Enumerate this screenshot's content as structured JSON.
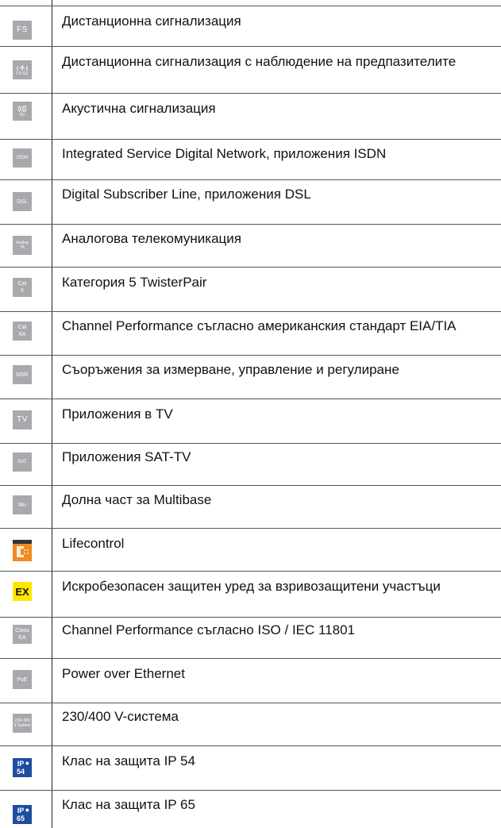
{
  "legend": {
    "rows": [
      {
        "icon": "FS",
        "icon_name": "fs-icon",
        "text": "Дистанционна сигнализация"
      },
      {
        "icon": "FS-SÜ",
        "icon_name": "fs-su-icon",
        "text": "Дистанционна сигнализация с наблюдение на предпазителите"
      },
      {
        "icon": "AS",
        "icon_name": "acoustic-signal-icon",
        "text": "Акустична сигнализация"
      },
      {
        "icon": "ISDN",
        "icon_name": "isdn-icon",
        "text": "Integrated Service Digital Network, приложения ISDN"
      },
      {
        "icon": "DSL",
        "icon_name": "dsl-icon",
        "text": "Digital Subscriber Line, приложения DSL"
      },
      {
        "icon": "Analog TK",
        "icon_name": "analog-tk-icon",
        "text": "Аналогова телекомуникация"
      },
      {
        "icon": "Cat 5",
        "icon_name": "cat5-icon",
        "text": "Категория 5 TwisterPair"
      },
      {
        "icon": "Cat 6A",
        "icon_name": "cat6a-icon",
        "text": "Channel Performance съгласно американския стандарт EIA/TIA"
      },
      {
        "icon": "MSR",
        "icon_name": "msr-icon",
        "text": "Съоръжения за измерване, управление и регулиране"
      },
      {
        "icon": "TV",
        "icon_name": "tv-icon",
        "text": "Приложения в TV"
      },
      {
        "icon": "SAT",
        "icon_name": "sat-icon",
        "text": "Приложения SAT-TV"
      },
      {
        "icon": "Mu",
        "icon_name": "multibase-icon",
        "text": "Долна част за Multibase"
      },
      {
        "icon": "Life Control",
        "icon_name": "lifecontrol-icon",
        "text": "Lifecontrol"
      },
      {
        "icon": "EX",
        "icon_name": "ex-icon",
        "text": "Искробезопасен защитен уред за взривозащитени участъци"
      },
      {
        "icon": "Class EA",
        "icon_name": "class-ea-icon",
        "text": "Channel Performance съгласно ISO / IEC 11801"
      },
      {
        "icon": "PoE",
        "icon_name": "poe-icon",
        "text": "Power over Ethernet"
      },
      {
        "icon": "230/ 400 V System",
        "icon_name": "230-400v-system-icon",
        "text": "230/400 V-система"
      },
      {
        "icon": "IP 54",
        "icon_name": "ip54-icon",
        "text": "Клас на защита IP 54"
      },
      {
        "icon": "IP 65",
        "icon_name": "ip65-icon",
        "text": "Клас на защита IP 65"
      }
    ]
  },
  "colors": {
    "icon_grey": "#a9a9ad",
    "ex_yellow": "#ffe600",
    "ip_blue": "#1d4e9e",
    "lifecontrol_orange": "#f08a1c"
  }
}
